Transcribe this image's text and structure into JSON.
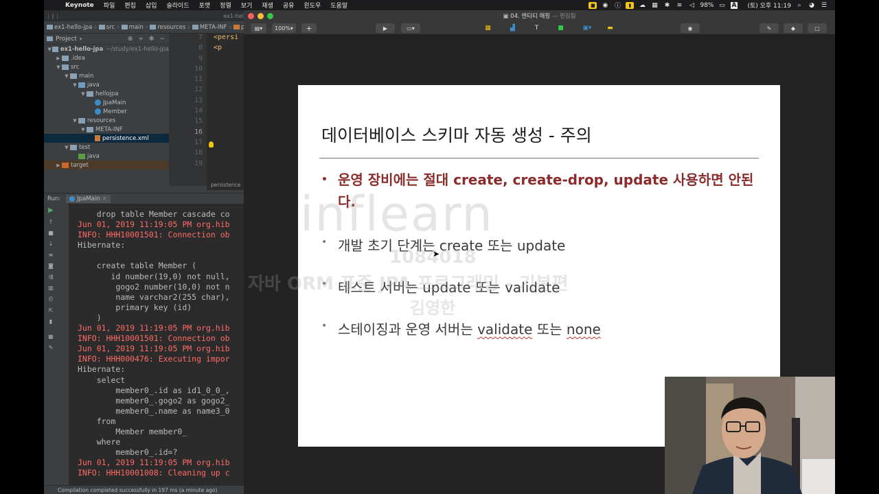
{
  "menubar": {
    "app": "Keynote",
    "items": [
      "파일",
      "편집",
      "삽입",
      "슬라이드",
      "포맷",
      "정렬",
      "보기",
      "재생",
      "공유",
      "윈도우",
      "도움말"
    ],
    "battery": "98%",
    "input_method": "A",
    "clock": "(토) 오후 11:19"
  },
  "ide": {
    "window_title": "ex1-hel",
    "breadcrumbs": [
      "ex1-hello-jpa",
      "src",
      "main",
      "resources",
      "META-INF",
      "p"
    ],
    "project_label": "Project",
    "tree": [
      {
        "label": "ex1-hello-jpa",
        "extra": "~/study/ex1-hello-jpa",
        "depth": 0,
        "arrow": "▼",
        "icon": "folder"
      },
      {
        "label": ".idea",
        "depth": 1,
        "arrow": "▶",
        "icon": "folder"
      },
      {
        "label": "src",
        "depth": 1,
        "arrow": "▼",
        "icon": "folder"
      },
      {
        "label": "main",
        "depth": 2,
        "arrow": "▼",
        "icon": "folder"
      },
      {
        "label": "java",
        "depth": 3,
        "arrow": "▼",
        "icon": "src"
      },
      {
        "label": "hellojpa",
        "depth": 4,
        "arrow": "▼",
        "icon": "folder"
      },
      {
        "label": "JpaMain",
        "depth": 5,
        "arrow": "",
        "icon": "cls"
      },
      {
        "label": "Member",
        "depth": 5,
        "arrow": "",
        "icon": "cls"
      },
      {
        "label": "resources",
        "depth": 3,
        "arrow": "▼",
        "icon": "folder"
      },
      {
        "label": "META-INF",
        "depth": 4,
        "arrow": "▼",
        "icon": "folder"
      },
      {
        "label": "persistence.xml",
        "depth": 5,
        "arrow": "",
        "icon": "xml",
        "selected": true
      },
      {
        "label": "test",
        "depth": 2,
        "arrow": "▼",
        "icon": "folder"
      },
      {
        "label": "java",
        "depth": 3,
        "arrow": "",
        "icon": "green"
      },
      {
        "label": "target",
        "depth": 1,
        "arrow": "▶",
        "icon": "orange",
        "target": true
      }
    ],
    "line_numbers": [
      "7",
      "8",
      "9",
      "10",
      "11",
      "12",
      "13",
      "14",
      "15",
      "16",
      "17",
      "18",
      "19"
    ],
    "current_line": "16",
    "code_lines": [
      "<persi",
      "  <p",
      "",
      "",
      "",
      "",
      "",
      "",
      "",
      "",
      "",
      "",
      ""
    ],
    "editor_file_label": "persistence",
    "run_label": "Run:",
    "run_tab": "JpaMain",
    "console": [
      {
        "text": "    drop table Member cascade co",
        "red": false
      },
      {
        "text": "Jun 01, 2019 11:19:05 PM org.hib",
        "red": true
      },
      {
        "text": "INFO: HHH10001501: Connection ob",
        "red": true
      },
      {
        "text": "Hibernate: ",
        "red": false
      },
      {
        "text": "",
        "red": false
      },
      {
        "text": "    create table Member (",
        "red": false
      },
      {
        "text": "       id number(19,0) not null,",
        "red": false
      },
      {
        "text": "        gogo2 number(10,0) not n",
        "red": false
      },
      {
        "text": "        name varchar2(255 char),",
        "red": false
      },
      {
        "text": "        primary key (id)",
        "red": false
      },
      {
        "text": "    )",
        "red": false
      },
      {
        "text": "Jun 01, 2019 11:19:05 PM org.hib",
        "red": true
      },
      {
        "text": "INFO: HHH10001501: Connection ob",
        "red": true
      },
      {
        "text": "Jun 01, 2019 11:19:05 PM org.hib",
        "red": true
      },
      {
        "text": "INFO: HHH000476: Executing impor",
        "red": true
      },
      {
        "text": "Hibernate: ",
        "red": false
      },
      {
        "text": "    select",
        "red": false
      },
      {
        "text": "        member0_.id as id1_0_0_,",
        "red": false
      },
      {
        "text": "        member0_.gogo2 as gogo2_",
        "red": false
      },
      {
        "text": "        member0_.name as name3_0",
        "red": false
      },
      {
        "text": "    from",
        "red": false
      },
      {
        "text": "        Member member0_",
        "red": false
      },
      {
        "text": "    where",
        "red": false
      },
      {
        "text": "        member0_.id=?",
        "red": false
      },
      {
        "text": "Jun 01, 2019 11:19:05 PM org.hib",
        "red": true
      },
      {
        "text": "INFO: HHH10001008: Cleaning up c",
        "red": true
      }
    ],
    "status": "Compilation completed successfully in 197 ms (a minute ago)"
  },
  "keynote": {
    "doc_title": "04. 엔티티 매핑",
    "doc_state": "— 편집됨",
    "zoom": "100%",
    "slide": {
      "title": "데이터베이스 스키마 자동 생성 - 주의",
      "bullets": [
        {
          "text": "운영 장비에는 절대 create, create-drop, update 사용하면 안된다.",
          "emphasis": true
        },
        {
          "text": "개발 초기 단계는 create 또는 update",
          "emphasis": false
        },
        {
          "text": "테스트 서버는 update 또는 validate",
          "emphasis": false
        },
        {
          "text_before": "스테이징과 운영 서버는 ",
          "u1": "validate",
          "mid": " 또는 ",
          "u2": "none",
          "emphasis": false
        }
      ]
    },
    "watermark": {
      "brand": "inflearn",
      "code": "1084018",
      "course": "자바 ORM 표준 JPA 프로그래밍 - 기본편",
      "name": "김영한"
    }
  },
  "colors": {
    "emphasis_red": "#8b2c2c",
    "console_red": "#ff6b68",
    "ide_bg": "#3c3f41",
    "keynote_bg": "#232323"
  }
}
